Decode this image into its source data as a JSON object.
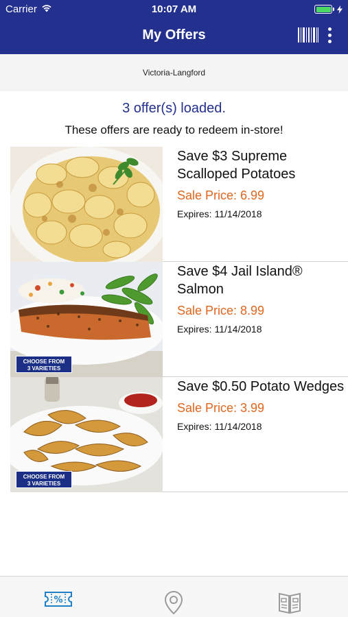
{
  "status": {
    "carrier": "Carrier",
    "time": "10:07 AM"
  },
  "nav": {
    "title": "My Offers",
    "icons": [
      "barcode-icon",
      "more-vertical-icon"
    ]
  },
  "store": {
    "name": "Victoria-Langford"
  },
  "summary": {
    "count_text": "3 offer(s) loaded.",
    "subtitle": "These offers are ready to redeem in-store!"
  },
  "offers": [
    {
      "title": "Save $3 Supreme Scalloped Potatoes",
      "price": "Sale Price: 6.99",
      "expires": "Expires: 11/14/2018",
      "badge": ""
    },
    {
      "title": "Save $4 Jail Island® Salmon",
      "price": "Sale Price: 8.99",
      "expires": "Expires: 11/14/2018",
      "badge_line1": "CHOOSE FROM",
      "badge_line2": "3 VARIETIES"
    },
    {
      "title": "Save $0.50 Potato Wedges",
      "price": "Sale Price: 3.99",
      "expires": "Expires: 11/14/2018",
      "badge_line1": "CHOOSE FROM",
      "badge_line2": "3 VARIETIES"
    }
  ],
  "tabs": [
    "offers-ticket-icon",
    "store-location-icon",
    "flyer-icon"
  ],
  "colors": {
    "brand": "#23308e",
    "price": "#e1661d",
    "active_tab": "#1f7fc6",
    "inactive_tab": "#9a9a9a"
  }
}
